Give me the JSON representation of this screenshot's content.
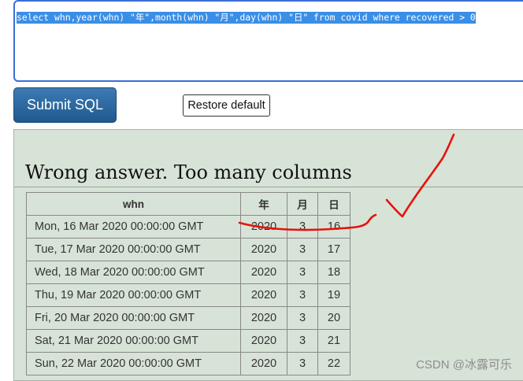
{
  "editor": {
    "sql": "select whn,year(whn) \"年\",month(whn) \"月\",day(whn) \"日\" from covid where recovered > 0"
  },
  "buttons": {
    "submit_label": "Submit SQL",
    "restore_label": "Restore default"
  },
  "result": {
    "title": "Wrong answer. Too many columns",
    "columns": [
      "whn",
      "年",
      "月",
      "日"
    ],
    "rows": [
      [
        "Mon, 16 Mar 2020 00:00:00 GMT",
        "2020",
        "3",
        "16"
      ],
      [
        "Tue, 17 Mar 2020 00:00:00 GMT",
        "2020",
        "3",
        "17"
      ],
      [
        "Wed, 18 Mar 2020 00:00:00 GMT",
        "2020",
        "3",
        "18"
      ],
      [
        "Thu, 19 Mar 2020 00:00:00 GMT",
        "2020",
        "3",
        "19"
      ],
      [
        "Fri, 20 Mar 2020 00:00:00 GMT",
        "2020",
        "3",
        "20"
      ],
      [
        "Sat, 21 Mar 2020 00:00:00 GMT",
        "2020",
        "3",
        "21"
      ],
      [
        "Sun, 22 Mar 2020 00:00:00 GMT",
        "2020",
        "3",
        "22"
      ]
    ]
  },
  "annotation": {
    "color": "#e8120c"
  },
  "watermark": "CSDN @冰露可乐"
}
